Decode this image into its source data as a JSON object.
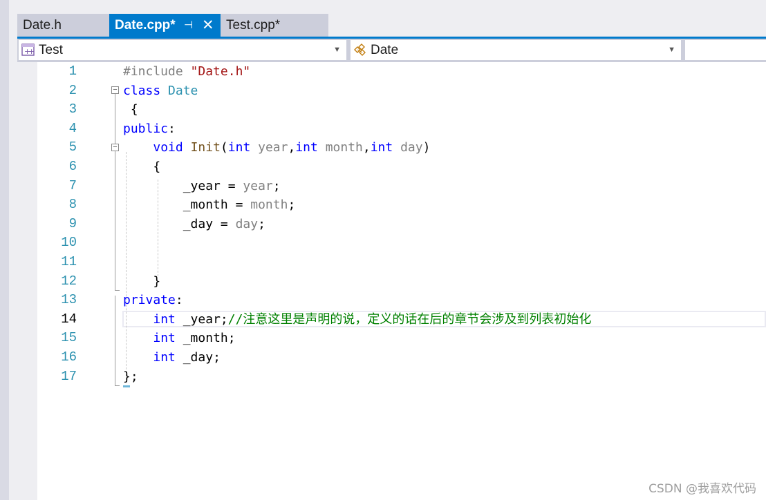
{
  "tabs": [
    {
      "label": "Date.h",
      "active": false
    },
    {
      "label": "Date.cpp*",
      "active": true
    },
    {
      "label": "Test.cpp*",
      "active": false
    }
  ],
  "tab_icons": {
    "pin": "⊣",
    "close": "✕"
  },
  "navbar": {
    "scope": "Test",
    "member": "Date",
    "extra": ""
  },
  "line_numbers": [
    "1",
    "2",
    "3",
    "4",
    "5",
    "6",
    "7",
    "8",
    "9",
    "10",
    "11",
    "12",
    "13",
    "14",
    "15",
    "16",
    "17"
  ],
  "current_line": 14,
  "code_text": {
    "include_kw": "#include",
    "include_file": "\"Date.h\"",
    "class_kw": "class",
    "class_name": "Date",
    "open_brace": "{",
    "public_kw": "public",
    "colon": ":",
    "void_kw": "void",
    "func_name": "Init",
    "int_kw": "int",
    "p_year": "year",
    "p_month": "month",
    "p_day": "day",
    "m_year": "_year",
    "m_month": "_month",
    "m_day": "_day",
    "eq": " = ",
    "close_brace": "}",
    "private_kw": "private",
    "comment": "//注意这里是声明的说，定义的话在后的章节会涉及到列表初始化",
    "class_end": "};"
  },
  "watermark": "CSDN @我喜欢代码",
  "colors": {
    "accent": "#007acc",
    "keyword": "#0000ff",
    "type": "#2b91af",
    "comment": "#008000",
    "string": "#a31515",
    "line_number": "#2b91af"
  }
}
